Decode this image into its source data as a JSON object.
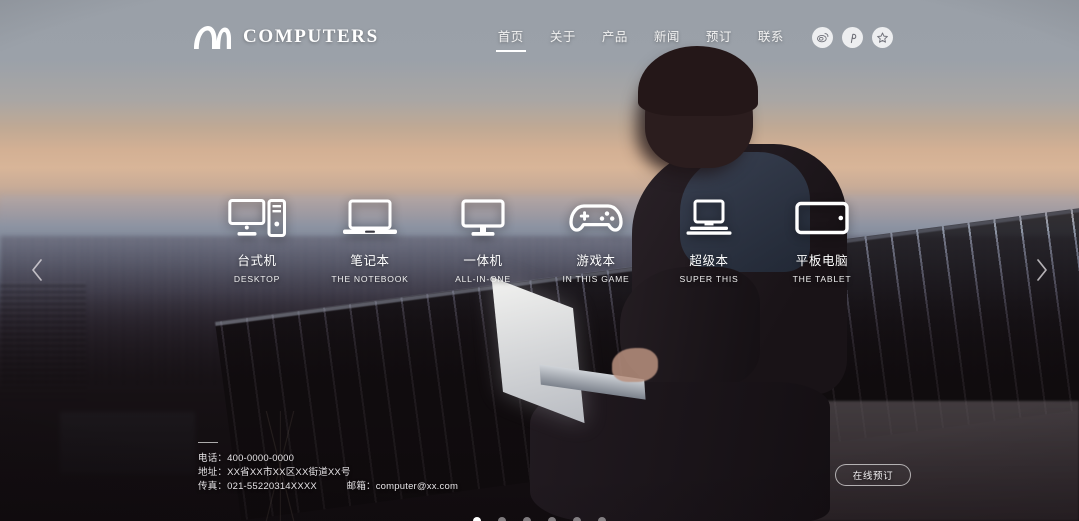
{
  "brand": {
    "logo_icon": "arch-m-logo-icon",
    "name": "COMPUTERS"
  },
  "nav": {
    "items": [
      {
        "label": "首页",
        "active": true
      },
      {
        "label": "关于",
        "active": false
      },
      {
        "label": "产品",
        "active": false
      },
      {
        "label": "新闻",
        "active": false
      },
      {
        "label": "预订",
        "active": false
      },
      {
        "label": "联系",
        "active": false
      }
    ]
  },
  "socials": [
    {
      "name": "weibo-icon",
      "glyph": "weibo"
    },
    {
      "name": "pinterest-icon",
      "glyph": "p"
    },
    {
      "name": "star-badge-icon",
      "glyph": "star"
    }
  ],
  "categories": [
    {
      "icon": "desktop-icon",
      "cn": "台式机",
      "en": "DESKTOP"
    },
    {
      "icon": "notebook-icon",
      "cn": "笔记本",
      "en": "THE NOTEBOOK"
    },
    {
      "icon": "all-in-one-icon",
      "cn": "一体机",
      "en": "ALL-IN-ONE"
    },
    {
      "icon": "gamepad-icon",
      "cn": "游戏本",
      "en": "IN THIS GAME"
    },
    {
      "icon": "ultrabook-icon",
      "cn": "超级本",
      "en": "SUPER THIS"
    },
    {
      "icon": "tablet-icon",
      "cn": "平板电脑",
      "en": "THE TABLET"
    }
  ],
  "carousel": {
    "prev_icon": "chevron-left-icon",
    "next_icon": "chevron-right-icon",
    "dots": 6,
    "active_dot": 0
  },
  "contact": {
    "line1": "电话：400-0000-0000",
    "line2": "地址：XX省XX市XX区XX街道XX号",
    "line3_fax": "传真：021-55220314XXXX",
    "line3_mail": "邮箱：computer@xx.com"
  },
  "booking": {
    "label": "在线预订"
  },
  "colors": {
    "text_on_hero": "#ffffff",
    "accent_underline": "#ffffff",
    "social_bubble": "#d2d2d4",
    "sky_top": "#9aa0a8",
    "sunset": "#d8b598",
    "foreground_dark": "#150f12"
  }
}
